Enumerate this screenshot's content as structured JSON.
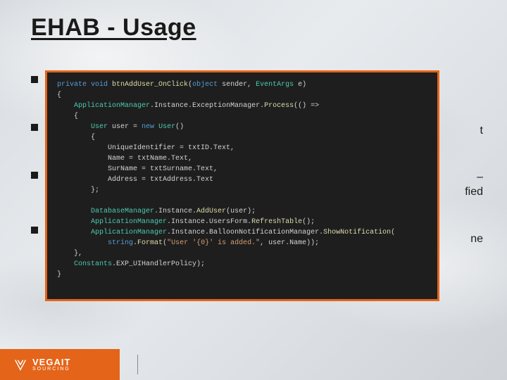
{
  "slide": {
    "title": "EHAB - Usage"
  },
  "background_text": {
    "frag1": "t",
    "frag2": "–",
    "frag3": "fied",
    "frag4": "ne"
  },
  "code": {
    "tokens": [
      {
        "t": "kw",
        "v": "private void"
      },
      {
        "t": "plain",
        "v": " "
      },
      {
        "t": "member",
        "v": "btnAddUser_OnClick"
      },
      {
        "t": "plain",
        "v": "("
      },
      {
        "t": "kw",
        "v": "object"
      },
      {
        "t": "plain",
        "v": " sender, "
      },
      {
        "t": "type",
        "v": "EventArgs"
      },
      {
        "t": "plain",
        "v": " e)"
      },
      {
        "t": "nl"
      },
      {
        "t": "plain",
        "v": "{"
      },
      {
        "t": "nl"
      },
      {
        "t": "plain",
        "v": "    "
      },
      {
        "t": "type",
        "v": "ApplicationManager"
      },
      {
        "t": "plain",
        "v": ".Instance.ExceptionManager."
      },
      {
        "t": "member",
        "v": "Process"
      },
      {
        "t": "plain",
        "v": "(() =>"
      },
      {
        "t": "nl"
      },
      {
        "t": "plain",
        "v": "    {"
      },
      {
        "t": "nl"
      },
      {
        "t": "plain",
        "v": "        "
      },
      {
        "t": "type",
        "v": "User"
      },
      {
        "t": "plain",
        "v": " user = "
      },
      {
        "t": "kw",
        "v": "new"
      },
      {
        "t": "plain",
        "v": " "
      },
      {
        "t": "type",
        "v": "User"
      },
      {
        "t": "plain",
        "v": "()"
      },
      {
        "t": "nl"
      },
      {
        "t": "plain",
        "v": "        {"
      },
      {
        "t": "nl"
      },
      {
        "t": "plain",
        "v": "            UniqueIdentifier = txtID.Text,"
      },
      {
        "t": "nl"
      },
      {
        "t": "plain",
        "v": "            Name = txtName.Text,"
      },
      {
        "t": "nl"
      },
      {
        "t": "plain",
        "v": "            SurName = txtSurname.Text,"
      },
      {
        "t": "nl"
      },
      {
        "t": "plain",
        "v": "            Address = txtAddress.Text"
      },
      {
        "t": "nl"
      },
      {
        "t": "plain",
        "v": "        };"
      },
      {
        "t": "nl"
      },
      {
        "t": "nl"
      },
      {
        "t": "plain",
        "v": "        "
      },
      {
        "t": "type",
        "v": "DatabaseManager"
      },
      {
        "t": "plain",
        "v": ".Instance."
      },
      {
        "t": "member",
        "v": "AddUser"
      },
      {
        "t": "plain",
        "v": "(user);"
      },
      {
        "t": "nl"
      },
      {
        "t": "plain",
        "v": "        "
      },
      {
        "t": "type",
        "v": "ApplicationManager"
      },
      {
        "t": "plain",
        "v": ".Instance.UsersForm."
      },
      {
        "t": "member",
        "v": "RefreshTable"
      },
      {
        "t": "plain",
        "v": "();"
      },
      {
        "t": "nl"
      },
      {
        "t": "plain",
        "v": "        "
      },
      {
        "t": "type",
        "v": "ApplicationManager"
      },
      {
        "t": "plain",
        "v": ".Instance.BalloonNotificationManager."
      },
      {
        "t": "member",
        "v": "ShowNotification"
      },
      {
        "t": "plain",
        "v": "("
      },
      {
        "t": "nl"
      },
      {
        "t": "plain",
        "v": "            "
      },
      {
        "t": "kw",
        "v": "string"
      },
      {
        "t": "plain",
        "v": "."
      },
      {
        "t": "member",
        "v": "Format"
      },
      {
        "t": "plain",
        "v": "("
      },
      {
        "t": "str",
        "v": "\"User '{0}' is added.\""
      },
      {
        "t": "plain",
        "v": ", user.Name));"
      },
      {
        "t": "nl"
      },
      {
        "t": "plain",
        "v": "    },"
      },
      {
        "t": "nl"
      },
      {
        "t": "plain",
        "v": "    "
      },
      {
        "t": "type",
        "v": "Constants"
      },
      {
        "t": "plain",
        "v": ".EXP_UIHandlerPolicy);"
      },
      {
        "t": "nl"
      },
      {
        "t": "plain",
        "v": "}"
      }
    ]
  },
  "footer": {
    "brand": "VEGAIT",
    "brand_sub": "SOURCING"
  }
}
